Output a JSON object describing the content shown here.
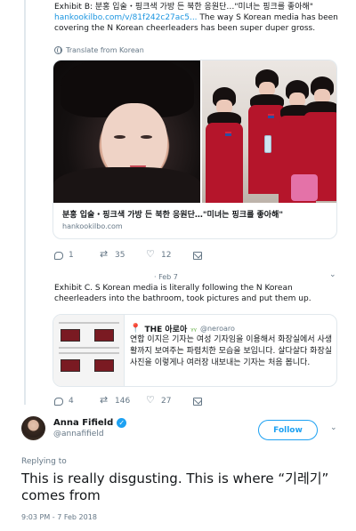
{
  "thread": {
    "tweet1": {
      "text_prefix": "Exhibit B: 분홍 입술・핑크색 가방 든 북한 응원단…\"미녀는 핑크를 좋아해\"",
      "link": "hankookilbo.com/v/81f242c27ac5...",
      "text_suffix": " The way S Korean media has been covering the N Korean cheerleaders has been super duper gross.",
      "translate_label": "Translate from Korean",
      "card": {
        "title": "분홍 입술・핑크색 가방 든 북한 응원단…\"미녀는 핑크를 좋아해\"",
        "domain": "hankookilbo.com"
      },
      "actions": {
        "replies": "1",
        "retweets": "35",
        "likes": "12"
      }
    },
    "tweet2": {
      "date": "· Feb 7",
      "text": "Exhibit C. S Korean media is literally following the N Korean cheerleaders into the bathroom, took pictures and put them up.",
      "quote": {
        "name": "THE 아로아",
        "handle": "@neroaro",
        "text": "연합 이지은 기자는 여성 기자임을 이용해서 화장실에서 사생활까지 보여주는 파렴치한 모습을 보입니다. 살다살다 화장실 사진을 이렇게나 여러장 내보내는 기자는 처음 봅니다."
      },
      "actions": {
        "replies": "4",
        "retweets": "146",
        "likes": "27"
      }
    }
  },
  "main_tweet": {
    "author_name": "Anna Fifield",
    "author_handle": "@annafifield",
    "follow_label": "Follow",
    "replying_to": "Replying to",
    "text": "This is really disgusting. This is where “기레기” comes from",
    "timestamp": "9:03 PM - 7 Feb 2018"
  },
  "colors": {
    "accent": "#1da1f2",
    "link": "#1b95e0",
    "muted": "#657786",
    "text": "#14171a",
    "border": "#e1e8ed"
  }
}
